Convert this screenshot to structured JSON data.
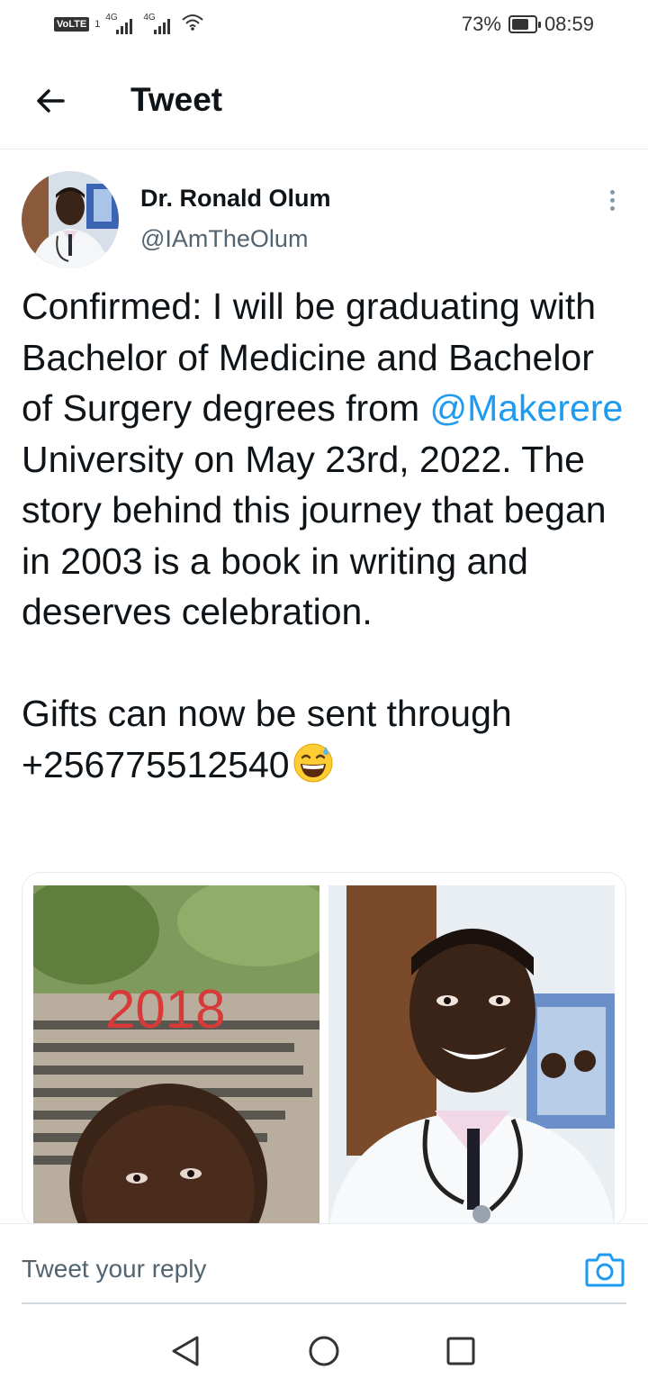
{
  "status_bar": {
    "volte_label": "VoLTE",
    "sim_label": "1",
    "net1": "4G",
    "net2": "4G",
    "battery_percent": "73%",
    "battery_level": 0.73,
    "time": "08:59"
  },
  "header": {
    "title": "Tweet"
  },
  "tweet": {
    "author_name": "Dr. Ronald Olum",
    "author_handle": "@IAmTheOlum",
    "text_before_mention": "Confirmed: I will be graduating with Bachelor of Medicine and Bachelor of Surgery degrees from ",
    "mention": "@Makerere",
    "text_after_mention": " University on May 23rd, 2022. The story behind this journey that began in 2003 is a book in writing and deserves celebration.",
    "text_second_paragraph": "Gifts can now be sent through +256775512540",
    "emoji_icon": "grinning-face-with-sweat-icon",
    "media": {
      "left_photo_caption": "2018"
    }
  },
  "reply": {
    "placeholder": "Tweet your reply",
    "camera_icon": "camera-icon"
  },
  "colors": {
    "accent": "#1d9bf0",
    "text": "#0f1419",
    "secondary_text": "#536471",
    "divider": "#e6ecf0"
  },
  "navbar": {
    "back_icon": "triangle-back-icon",
    "home_icon": "circle-home-icon",
    "recents_icon": "square-recents-icon"
  }
}
